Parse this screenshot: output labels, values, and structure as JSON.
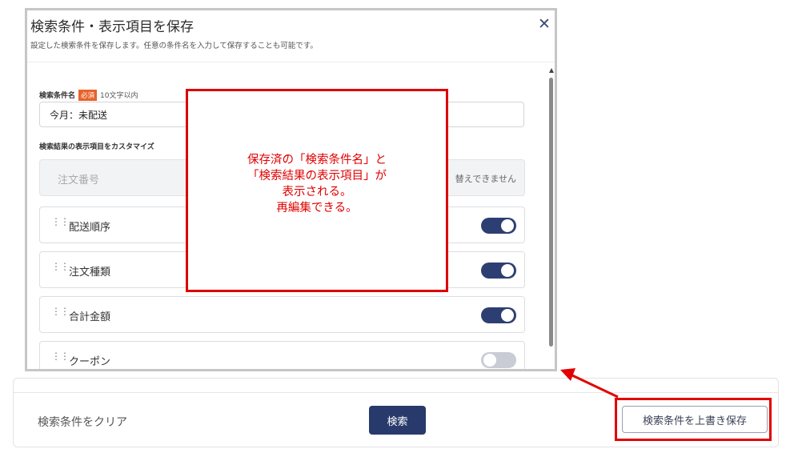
{
  "modal": {
    "title": "検索条件・表示項目を保存",
    "close": "✕",
    "subtitle": "設定した検索条件を保存します。任意の条件名を入力して保存することも可能です。",
    "name_label": "検索条件名",
    "required_badge": "必須",
    "name_hint": "10文字以内",
    "name_value": "今月：未配送",
    "display_label": "検索結果の表示項目をカスタマイズ",
    "fixed_item": "注文番号",
    "fixed_note": "替えできません",
    "items": [
      {
        "label": "配送順序",
        "enabled": true
      },
      {
        "label": "注文種類",
        "enabled": true
      },
      {
        "label": "合計金額",
        "enabled": true
      },
      {
        "label": "クーポン",
        "enabled": false
      }
    ]
  },
  "footer": {
    "clear_label": "検索条件をクリア",
    "search_label": "検索",
    "overwrite_label": "検索条件を上書き保存"
  },
  "annotation": {
    "lines": [
      "保存済の「検索条件名」と",
      "「検索結果の表示項目」が",
      "表示される。",
      "再編集できる。"
    ],
    "color": "#e00000"
  },
  "colors": {
    "primary": "#273a6b",
    "badge": "#e8622a",
    "highlight": "#e30000"
  }
}
